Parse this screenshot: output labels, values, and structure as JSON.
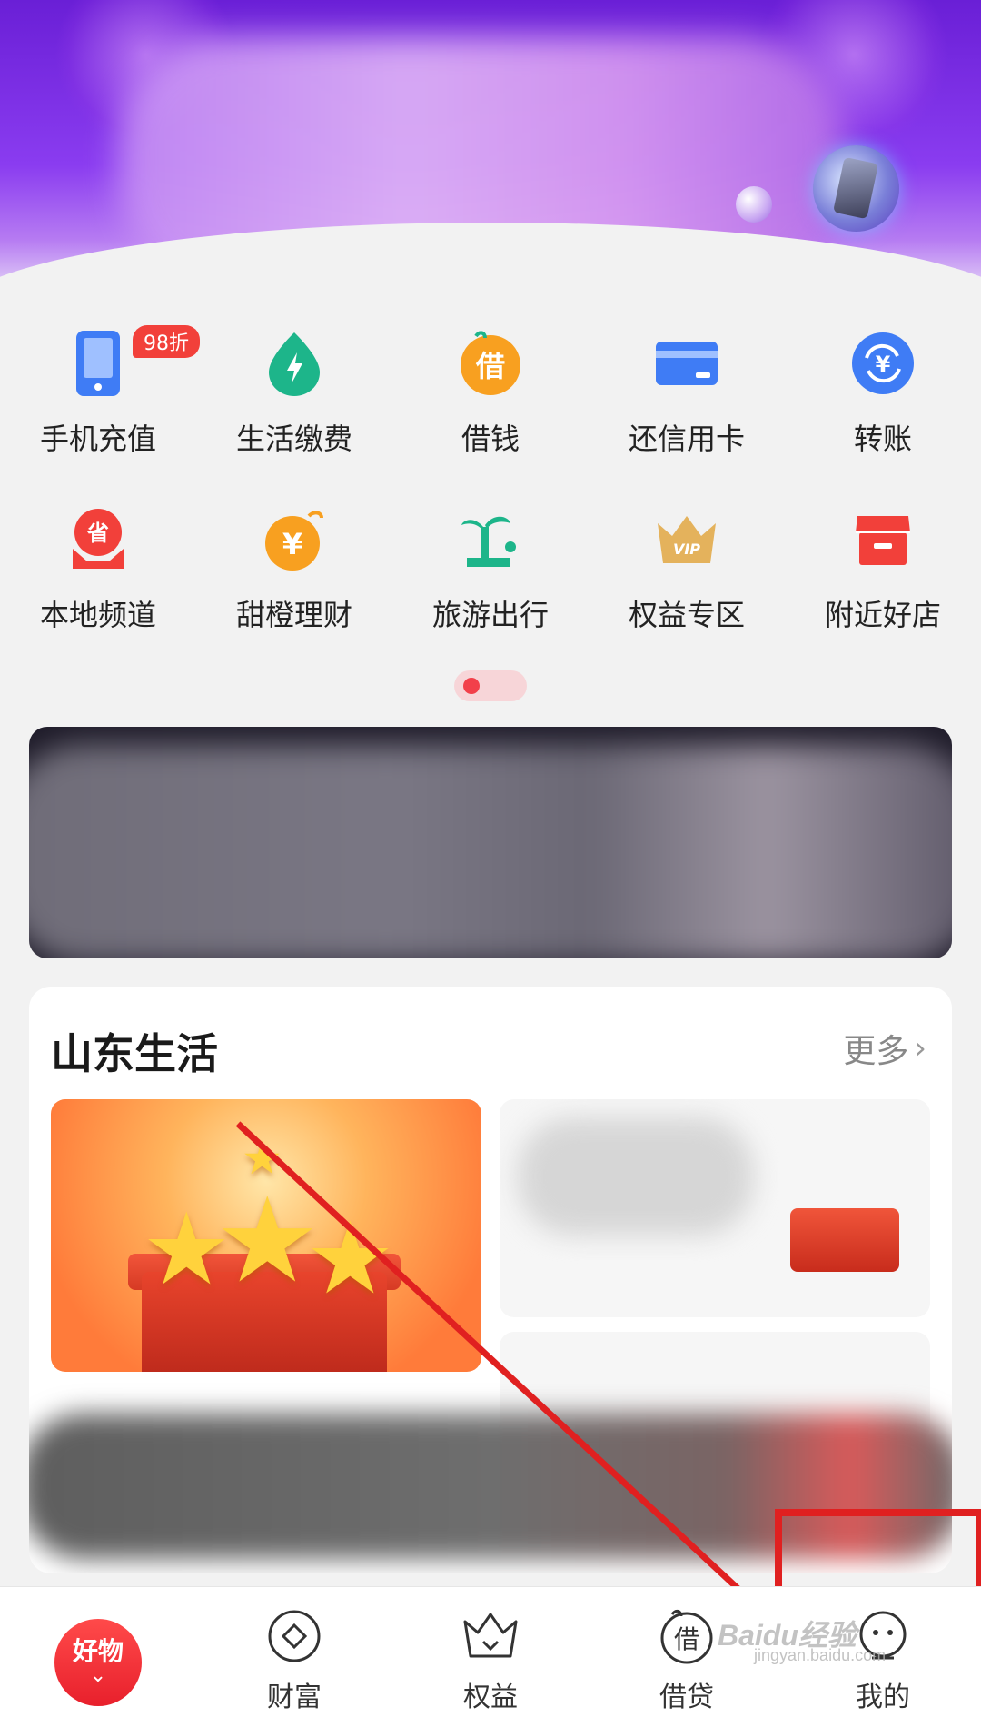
{
  "shortcuts": [
    {
      "label": "手机充值",
      "icon": "phone-recharge-icon",
      "color": "#3f7cf5",
      "badge": "98折"
    },
    {
      "label": "生活缴费",
      "icon": "utility-payment-icon",
      "color": "#1db58a"
    },
    {
      "label": "借钱",
      "icon": "borrow-icon",
      "color": "#f8a020",
      "glyph": "借"
    },
    {
      "label": "还信用卡",
      "icon": "credit-card-icon",
      "color": "#3f7cf5"
    },
    {
      "label": "转账",
      "icon": "transfer-icon",
      "color": "#3f7cf5",
      "glyph": "¥"
    },
    {
      "label": "本地频道",
      "icon": "local-channel-icon",
      "color": "#f2403a",
      "glyph": "省"
    },
    {
      "label": "甜橙理财",
      "icon": "wealth-management-icon",
      "color": "#f8a020",
      "glyph": "¥"
    },
    {
      "label": "旅游出行",
      "icon": "travel-icon",
      "color": "#1db58a"
    },
    {
      "label": "权益专区",
      "icon": "vip-crown-icon",
      "color": "#e4b25c",
      "glyph": "VIP"
    },
    {
      "label": "附近好店",
      "icon": "nearby-store-icon",
      "color": "#f2403a"
    }
  ],
  "section": {
    "title": "山东生活",
    "more": "更多",
    "more_icon": "chevron-right-icon"
  },
  "tabbar": {
    "home": {
      "label": "好物",
      "icon": "chevron-down-icon",
      "color": "#e8202c"
    },
    "items": [
      {
        "label": "财富",
        "icon": "wealth-diamond-icon"
      },
      {
        "label": "权益",
        "icon": "crown-icon"
      },
      {
        "label": "借贷",
        "icon": "loan-icon",
        "glyph": "借"
      },
      {
        "label": "我的",
        "icon": "profile-icon"
      }
    ]
  },
  "watermark": {
    "main": "Baidu经验",
    "sub": "jingyan.baidu.com"
  },
  "annotation": {
    "color": "#e02020"
  }
}
